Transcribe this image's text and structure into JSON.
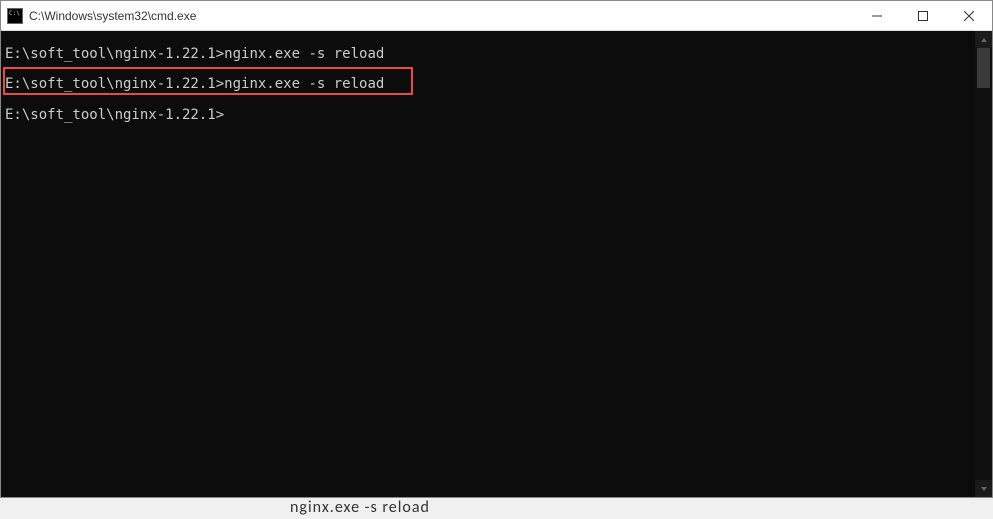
{
  "window": {
    "title": "C:\\Windows\\system32\\cmd.exe"
  },
  "terminal": {
    "lines": [
      {
        "prompt": "E:\\soft_tool\\nginx-1.22.1>",
        "command": "nginx.exe -s reload",
        "highlighted": false
      },
      {
        "prompt": "E:\\soft_tool\\nginx-1.22.1>",
        "command": "nginx.exe -s reload",
        "highlighted": true
      },
      {
        "prompt": "E:\\soft_tool\\nginx-1.22.1>",
        "command": "",
        "highlighted": false
      }
    ]
  },
  "partial_text_below": "nginx.exe   -s reload",
  "highlight": {
    "color": "#e74c3c"
  }
}
